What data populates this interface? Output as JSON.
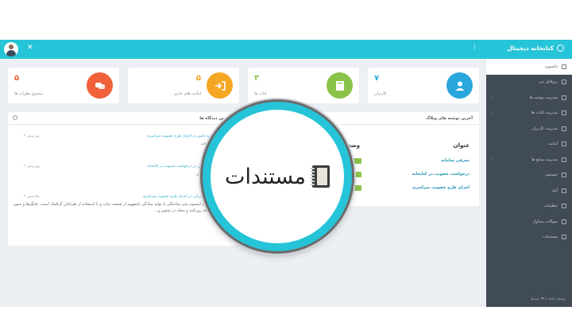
{
  "brand": {
    "title": "کتابخانه دیجیتال"
  },
  "topbar": {
    "menu_icon": "⁝",
    "close_icon": "✕"
  },
  "sidebar": {
    "items": [
      {
        "label": "داشبورد",
        "active": true
      },
      {
        "label": "پروفایل من"
      },
      {
        "label": "مدیریت نوشته ها"
      },
      {
        "label": "مدیریت کتاب ها"
      },
      {
        "label": "مدیریت کاربران"
      },
      {
        "label": "امانت"
      },
      {
        "label": "مدیریت منابع ها"
      },
      {
        "label": "جستجو"
      },
      {
        "label": "آمار"
      },
      {
        "label": "تنظیمات"
      },
      {
        "label": "سوالات متداول"
      },
      {
        "label": "مستندات"
      }
    ],
    "footer": "توسعه یافته با ❤ توسط"
  },
  "stats": {
    "users": {
      "value": "۷",
      "label": "کاربران",
      "color": "#2aa7dc"
    },
    "books": {
      "value": "۳",
      "label": "کتاب ها",
      "color": "#8bc34a"
    },
    "loans": {
      "value": "۵",
      "label": "امانت های جاری",
      "color": "#f5a623"
    },
    "comments": {
      "value": "۵",
      "label": "مجموع نظرات ها",
      "color": "#f0613a"
    }
  },
  "comments_panel": {
    "title": "آخرین دیدگاه ها",
    "items": [
      {
        "meta": "توحید دانش در اجرای طرح عضویت سراسری",
        "text": "تشکرات",
        "time": "۳ روز پیش"
      },
      {
        "meta": "توحید دانش در درخواست عضویت در کتابخانه",
        "text": "بسیار عالی",
        "time": "۳ روز پیش"
      },
      {
        "meta": "رضا قربانی در اجرای طرح عضویت سراسری",
        "text": "لورم ایپسوم متن ساختگی با تولید سادگی نامفهوم از صنعت چاپ و با استفاده از طراحان گرافیک است. چاپگرها و متون بلکه روزنامه و مجله در ستون و...",
        "time": "۳ ماه پیش"
      }
    ]
  },
  "posts_panel": {
    "title": "آخرین نوشته های وبلاگ",
    "col_title": "عنوان",
    "col_status": "وضعیت",
    "rows": [
      {
        "title": "معرفی سامانه"
      },
      {
        "title": "درخواست عضویت در کتابخانه"
      },
      {
        "title": "اجرای طرح عضویت سراسری"
      }
    ]
  },
  "magnifier": {
    "label": "مستندات"
  },
  "colors": {
    "accent": "#26c4d8",
    "sidebar": "#414b56",
    "background": "#eceff3"
  }
}
